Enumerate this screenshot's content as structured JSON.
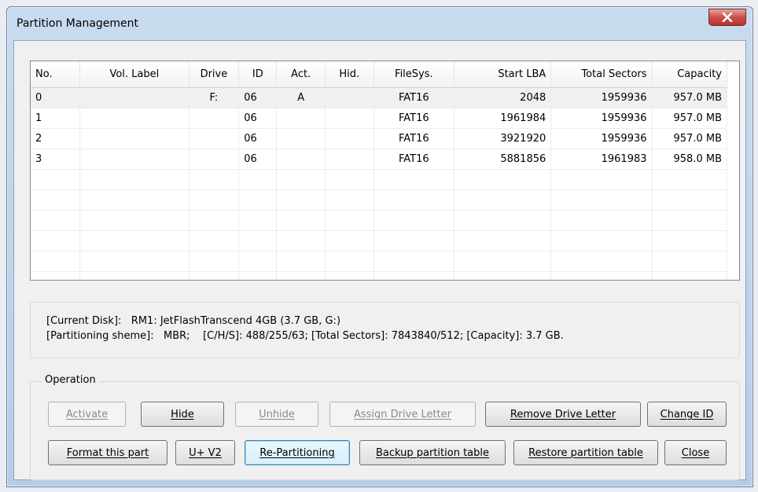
{
  "window": {
    "title": "Partition Management"
  },
  "table": {
    "columns": [
      "No.",
      "Vol. Label",
      "Drive",
      "ID",
      "Act.",
      "Hid.",
      "FileSys.",
      "Start LBA",
      "Total Sectors",
      "Capacity"
    ],
    "rows": [
      [
        "0",
        "",
        "F:",
        "06",
        "A",
        "",
        "FAT16",
        "2048",
        "1959936",
        "957.0 MB"
      ],
      [
        "1",
        "",
        "",
        "06",
        "",
        "",
        "FAT16",
        "1961984",
        "1959936",
        "957.0 MB"
      ],
      [
        "2",
        "",
        "",
        "06",
        "",
        "",
        "FAT16",
        "3921920",
        "1959936",
        "957.0 MB"
      ],
      [
        "3",
        "",
        "",
        "06",
        "",
        "",
        "FAT16",
        "5881856",
        "1961983",
        "958.0 MB"
      ]
    ],
    "selected_row": 0
  },
  "info": {
    "current_disk": "[Current Disk]:   RM1: JetFlashTranscend 4GB (3.7 GB, G:)",
    "partitioning": "[Partitioning sheme]:   MBR;    [C/H/S]: 488/255/63; [Total Sectors]: 7843840/512; [Capacity]: 3.7 GB."
  },
  "operation": {
    "legend": "Operation",
    "activate": "Activate",
    "hide": "Hide",
    "unhide": "Unhide",
    "assign_letter": "Assign Drive Letter",
    "remove_letter": "Remove Drive Letter",
    "change_id": "Change ID",
    "format": "Format this part",
    "uv2": "U+ V2",
    "repartition": "Re-Partitioning",
    "backup": "Backup partition table",
    "restore": "Restore partition table",
    "close": "Close"
  }
}
